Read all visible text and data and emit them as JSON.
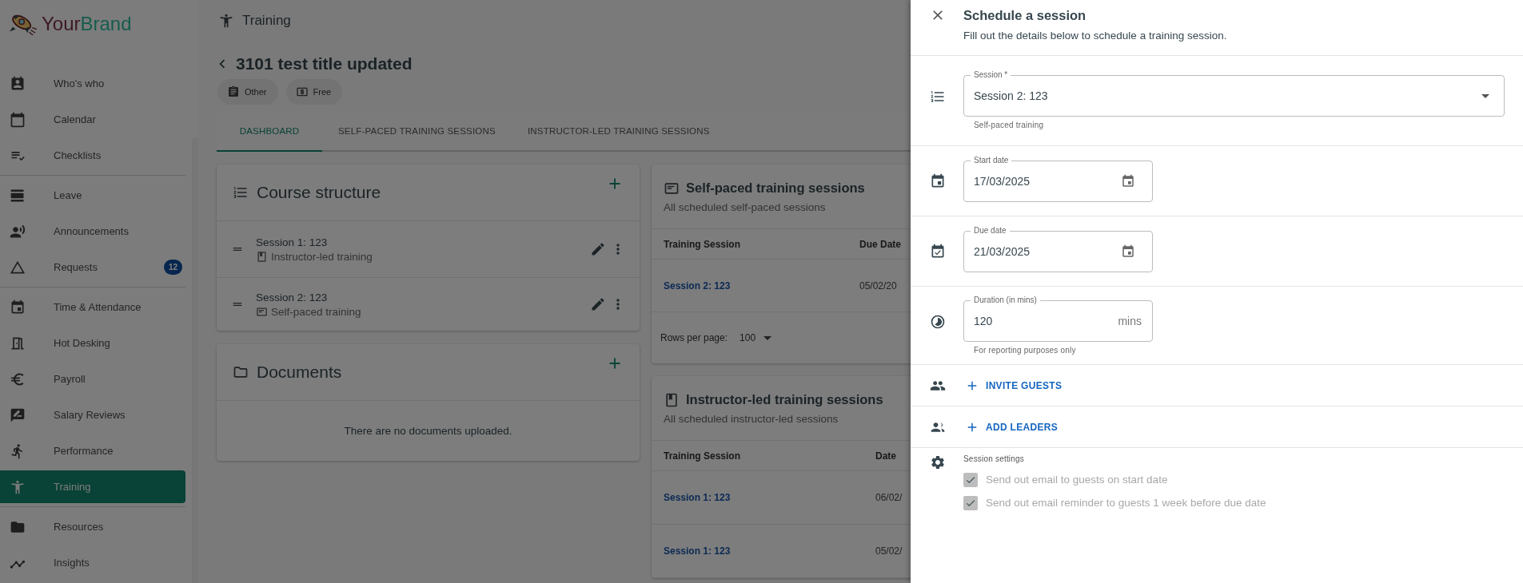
{
  "brand": {
    "first": "Your",
    "second": "Brand"
  },
  "sidebar": {
    "groups": [
      {
        "items": [
          {
            "label": "Who's who",
            "selected": false
          },
          {
            "label": "Calendar",
            "selected": false
          },
          {
            "label": "Checklists",
            "selected": false
          }
        ]
      },
      {
        "items": [
          {
            "label": "Leave",
            "selected": false
          },
          {
            "label": "Announcements",
            "selected": false
          },
          {
            "label": "Requests",
            "selected": false,
            "badge": "12"
          }
        ]
      },
      {
        "items": [
          {
            "label": "Time & Attendance",
            "selected": false
          },
          {
            "label": "Hot Desking",
            "selected": false
          },
          {
            "label": "Payroll",
            "selected": false
          },
          {
            "label": "Salary Reviews",
            "selected": false
          },
          {
            "label": "Performance",
            "selected": false
          },
          {
            "label": "Training",
            "selected": true
          }
        ]
      },
      {
        "items": [
          {
            "label": "Resources",
            "selected": false
          },
          {
            "label": "Insights",
            "selected": false
          }
        ]
      }
    ]
  },
  "header": {
    "section": "Training"
  },
  "page": {
    "title": "3101 test title updated",
    "chips": [
      {
        "label": "Other",
        "kind": "category"
      },
      {
        "label": "Free",
        "kind": "price"
      }
    ]
  },
  "tabs": [
    {
      "label": "DASHBOARD",
      "selected": true
    },
    {
      "label": "SELF-PACED TRAINING SESSIONS",
      "selected": false
    },
    {
      "label": "INSTRUCTOR-LED TRAINING SESSIONS",
      "selected": false
    }
  ],
  "course_structure": {
    "title": "Course structure",
    "items": [
      {
        "title": "Session 1: 123",
        "type_label": "Instructor-led training",
        "kind": "instructor"
      },
      {
        "title": "Session 2: 123",
        "type_label": "Self-paced training",
        "kind": "self"
      }
    ]
  },
  "documents": {
    "title": "Documents",
    "empty_text": "There are no documents uploaded."
  },
  "self_paced": {
    "title": "Self-paced training sessions",
    "subtitle": "All scheduled self-paced sessions",
    "columns": [
      "Training Session",
      "Due Date"
    ],
    "rows": [
      [
        "Session 2: 123",
        "05/02/20"
      ]
    ],
    "rows_per_page_label": "Rows per page:",
    "rows_per_page": "100"
  },
  "instructor_led": {
    "title": "Instructor-led training sessions",
    "subtitle": "All scheduled instructor-led sessions",
    "columns": [
      "Training Session",
      "Date"
    ],
    "rows": [
      [
        "Session 1: 123",
        "06/02/"
      ],
      [
        "Session 1: 123",
        "05/02/"
      ]
    ]
  },
  "drawer": {
    "title": "Schedule a session",
    "subtitle": "Fill out the details below to schedule a training session.",
    "session": {
      "label": "Session *",
      "value": "Session 2: 123",
      "helper": "Self-paced training"
    },
    "start_date": {
      "label": "Start date",
      "value": "17/03/2025"
    },
    "due_date": {
      "label": "Due date",
      "value": "21/03/2025"
    },
    "duration": {
      "label": "Duration (in mins)",
      "value": "120",
      "suffix": "mins",
      "helper": "For reporting purposes only"
    },
    "actions": [
      {
        "label": "INVITE GUESTS"
      },
      {
        "label": "ADD LEADERS"
      }
    ],
    "settings": {
      "label": "Session settings",
      "options": [
        {
          "label": "Send out email to guests on start date",
          "checked": true,
          "disabled": true
        },
        {
          "label": "Send out email reminder to guests 1 week before due date",
          "checked": true,
          "disabled": true
        }
      ]
    }
  }
}
